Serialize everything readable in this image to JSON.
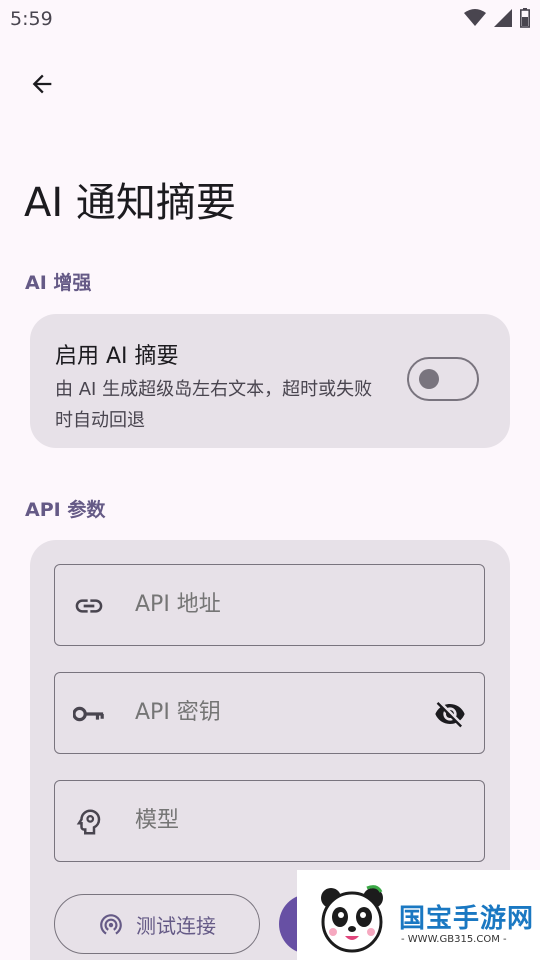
{
  "status_bar": {
    "time": "5:59"
  },
  "page": {
    "title": "AI 通知摘要"
  },
  "ai_section": {
    "label": "AI 增强",
    "toggle": {
      "title": "启用 AI 摘要",
      "description": "由 AI 生成超级岛左右文本，超时或失败时自动回退",
      "enabled": false
    }
  },
  "api_section": {
    "label": "API 参数",
    "fields": {
      "url": {
        "placeholder": "API 地址",
        "icon": "link-icon"
      },
      "key": {
        "placeholder": "API 密钥",
        "icon": "key-icon",
        "trailing_icon": "visibility-off-icon"
      },
      "model": {
        "placeholder": "模型",
        "icon": "psychology-icon"
      }
    },
    "test_button": {
      "label": "测试连接",
      "icon": "wifi-tethering-icon"
    }
  },
  "watermark": {
    "name": "国宝手游网",
    "url": "- WWW.GB315.COM -"
  },
  "colors": {
    "background": "#fdf7fc",
    "card": "#e7e1e8",
    "accent": "#655a86",
    "primary": "#6750a4",
    "outline": "#79747e"
  }
}
